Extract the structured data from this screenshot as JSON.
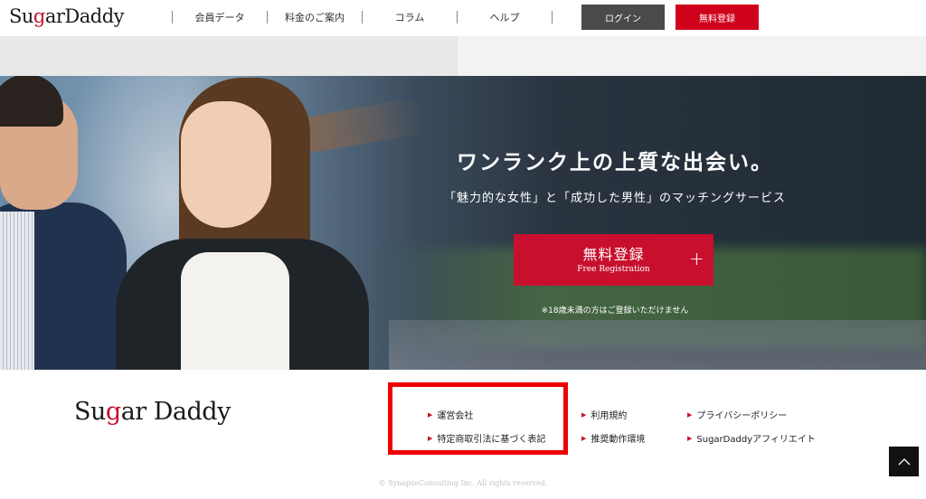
{
  "header": {
    "logo_prefix": "Su",
    "logo_accent": "g",
    "logo_suffix": "arDaddy",
    "nav": [
      "会員データ",
      "料金のご案内",
      "コラム",
      "ヘルプ"
    ],
    "login_label": "ログイン",
    "signup_label": "無料登録"
  },
  "hero": {
    "title": "ワンランク上の上質な出会い。",
    "subtitle": "「魅力的な女性」と「成功した男性」のマッチングサービス",
    "cta_main": "無料登録",
    "cta_sub": "Free Registration",
    "cta_plus": "+",
    "note": "※18歳未満の方はご登録いただけません"
  },
  "footer": {
    "logo_prefix": "Su",
    "logo_accent": "g",
    "logo_suffix": "ar Daddy",
    "links": [
      "運営会社",
      "特定商取引法に基づく表記",
      "利用規約",
      "推奨動作環境",
      "プライバシーポリシー",
      "SugarDaddyアフィリエイト"
    ],
    "copyright": "© SynapseConsulting Inc. All rights reserved."
  },
  "colors": {
    "brand_red": "#c8102e",
    "login_grey": "#4a4a4a",
    "highlight_red": "#ee0000"
  },
  "icons": {
    "link_arrow": "triangle-right-icon",
    "to_top": "chevron-up-icon",
    "cta_plus": "plus-icon"
  }
}
